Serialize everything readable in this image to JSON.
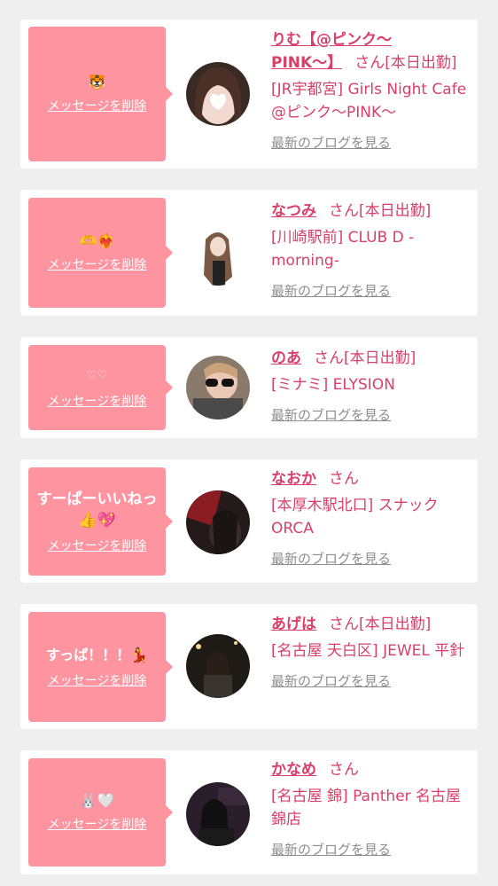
{
  "cards": [
    {
      "message": "🐯",
      "delete_label": "メッセージを削除",
      "name": "りむ【@ピンク〜PINK〜】",
      "name_line1": "りむ【@ピンク〜",
      "name_line2": "PINK〜】",
      "san": "さん",
      "status": "[本日出勤]",
      "shop": "[JR宇都宮] Girls Night Cafe @ピンク〜PINK〜",
      "blog_label": "最新のブログを見る"
    },
    {
      "message": "🫶❤️‍🔥",
      "delete_label": "メッセージを削除",
      "name": "なつみ",
      "san": "さん",
      "status": "[本日出勤]",
      "shop": "[川崎駅前] CLUB D -morning-",
      "blog_label": "最新のブログを見る"
    },
    {
      "message": "♡♡",
      "delete_label": "メッセージを削除",
      "name": "のあ",
      "san": "さん",
      "status": "[本日出勤]",
      "shop": "[ミナミ] ELYSION",
      "blog_label": "最新のブログを見る"
    },
    {
      "message": "すーぱーいいねっ👍💖",
      "delete_label": "メッセージを削除",
      "name": "なおか",
      "san": "さん",
      "status": "",
      "shop": "[本厚木駅北口] スナック ORCA",
      "blog_label": "最新のブログを見る"
    },
    {
      "message": "すっぱ！！！💃",
      "delete_label": "メッセージを削除",
      "name": "あげは",
      "san": "さん",
      "status": "[本日出勤]",
      "shop": "[名古屋 天白区] JEWEL 平針",
      "blog_label": "最新のブログを見る"
    },
    {
      "message": "🐰🤍",
      "delete_label": "メッセージを削除",
      "name": "かなめ",
      "san": "さん",
      "status": "",
      "shop": "[名古屋 錦] Panther 名古屋錦店",
      "blog_label": "最新のブログを見る"
    }
  ],
  "colors": {
    "page_bg": "#efefef",
    "bubble_bg": "#fd949f",
    "accent": "#d93f69",
    "link_gray": "#8d8d8d"
  }
}
